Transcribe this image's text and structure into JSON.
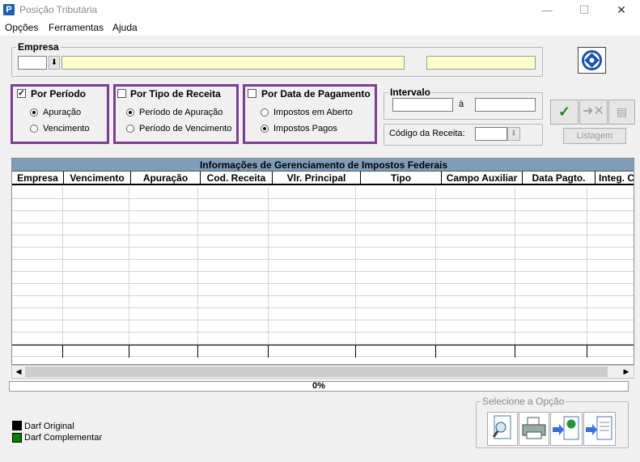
{
  "window": {
    "title": "Posição Tributária",
    "icon_letter": "P",
    "controls": {
      "minimize": "—",
      "maximize": "☐",
      "close": "✕"
    }
  },
  "menu": [
    "Opções",
    "Ferramentas",
    "Ajuda"
  ],
  "empresa": {
    "label": "Empresa",
    "code": "",
    "name": "",
    "extra": ""
  },
  "por_periodo": {
    "label": "Por Período",
    "checked": true,
    "options": [
      "Apuração",
      "Vencimento"
    ],
    "selected": "Apuração"
  },
  "por_tipo": {
    "label": "Por Tipo de Receita",
    "checked": false,
    "options": [
      "Período de Apuração",
      "Período de Vencimento"
    ],
    "selected": "Período de Apuração"
  },
  "por_data": {
    "label": "Por Data de Pagamento",
    "checked": false,
    "options": [
      "Impostos em Aberto",
      "Impostos Pagos"
    ],
    "selected": "Impostos Pagos"
  },
  "intervalo": {
    "label": "Intervalo",
    "from": "",
    "separator": "à",
    "to": ""
  },
  "codigo_receita": {
    "label": "Código da Receita:",
    "value": ""
  },
  "toolbar": {
    "listagem": "Listagem"
  },
  "grid": {
    "title": "Informações de Gerenciamento de Impostos Federais",
    "columns": [
      "Empresa",
      "Vencimento",
      "Apuração",
      "Cod. Receita",
      "Vlr. Principal",
      "Tipo",
      "Campo Auxiliar",
      "Data Pagto.",
      "Integ. C"
    ],
    "row_count": 14
  },
  "progress": {
    "value": 0,
    "text": "0%"
  },
  "legend": [
    {
      "label": "Darf Original",
      "color": "#000000"
    },
    {
      "label": "Darf Complementar",
      "color": "#008000"
    }
  ],
  "select_option": {
    "label": "Selecione a Opção"
  },
  "colors": {
    "highlight": "#7b3f8f",
    "grid_title": "#7f9db9",
    "field_yellow": "#ffffcc"
  }
}
